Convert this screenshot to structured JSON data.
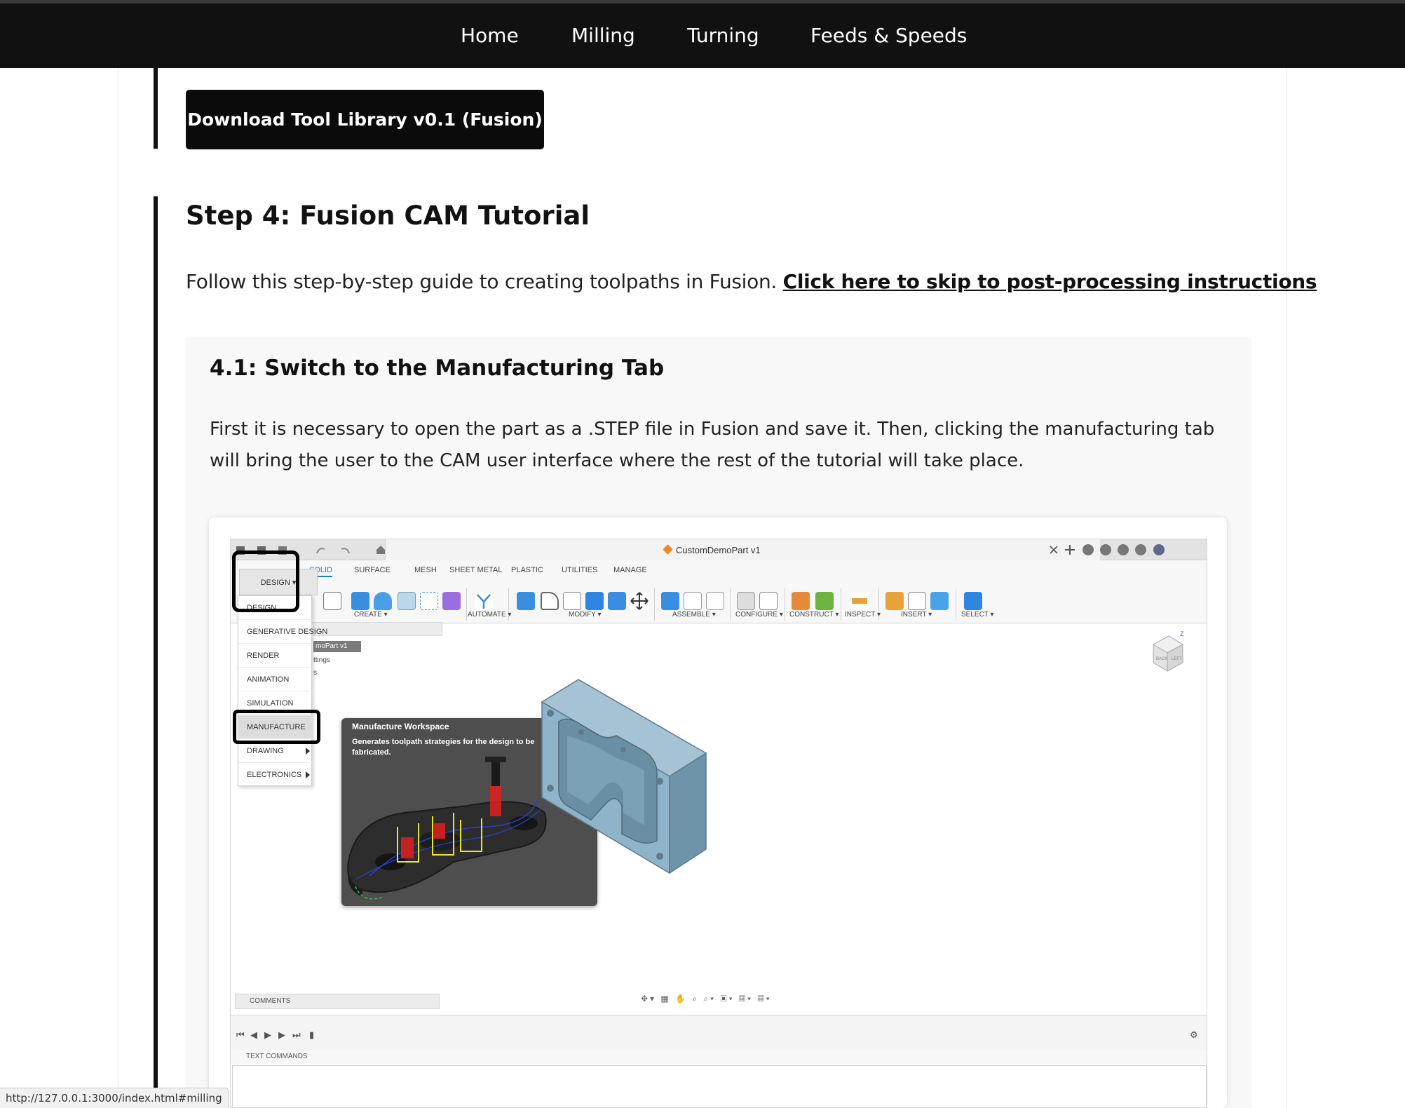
{
  "nav": {
    "links": [
      "Home",
      "Milling",
      "Turning",
      "Feeds & Speeds"
    ]
  },
  "download_button": "Download Tool Library v0.1 (Fusion)",
  "step": {
    "title": "Step 4: Fusion CAM Tutorial",
    "intro_text": "Follow this step-by-step guide to creating toolpaths in Fusion. ",
    "intro_link": "Click here to skip to post-processing instructions"
  },
  "substep": {
    "title": "4.1: Switch to the Manufacturing Tab",
    "body": "First it is necessary to open the part as a .STEP file in Fusion and save it. Then, clicking the manufacturing tab will bring the user to the CAM user interface where the rest of the tutorial will take place."
  },
  "fusion": {
    "document_title": "CustomDemoPart v1",
    "ribbon_tabs": [
      "SOLID",
      "SURFACE",
      "MESH",
      "SHEET METAL",
      "PLASTIC",
      "UTILITIES",
      "MANAGE"
    ],
    "active_tab": "SOLID",
    "groups": [
      "CREATE ▾",
      "AUTOMATE ▾",
      "MODIFY ▾",
      "ASSEMBLE ▾",
      "CONFIGURE ▾",
      "CONSTRUCT ▾",
      "INSPECT ▾",
      "INSERT ▾",
      "SELECT ▾"
    ],
    "workspace_button": "DESIGN ▾",
    "workspace_menu": [
      "DESIGN",
      "GENERATIVE DESIGN",
      "RENDER",
      "ANIMATION",
      "SIMULATION",
      "MANUFACTURE",
      "DRAWING",
      "ELECTRONICS"
    ],
    "highlighted_item": "MANUFACTURE",
    "browser_part": "moPart v1",
    "browser_settings": "ttings",
    "browser_s": "s",
    "tooltip_title": "Manufacture Workspace",
    "tooltip_desc": "Generates toolpath strategies for the design to be fabricated.",
    "comments_label": "COMMENTS",
    "text_commands_label": "TEXT COMMANDS",
    "viewcube_labels": [
      "LEFT",
      "BACK"
    ],
    "viewcube_axis": "Z",
    "colors": {
      "accent": "#1e7ec8",
      "part_blue": "#8fb3c8",
      "tooltip_bg": "#4e4e4e"
    }
  },
  "status_url": "http://127.0.0.1:3000/index.html#milling"
}
